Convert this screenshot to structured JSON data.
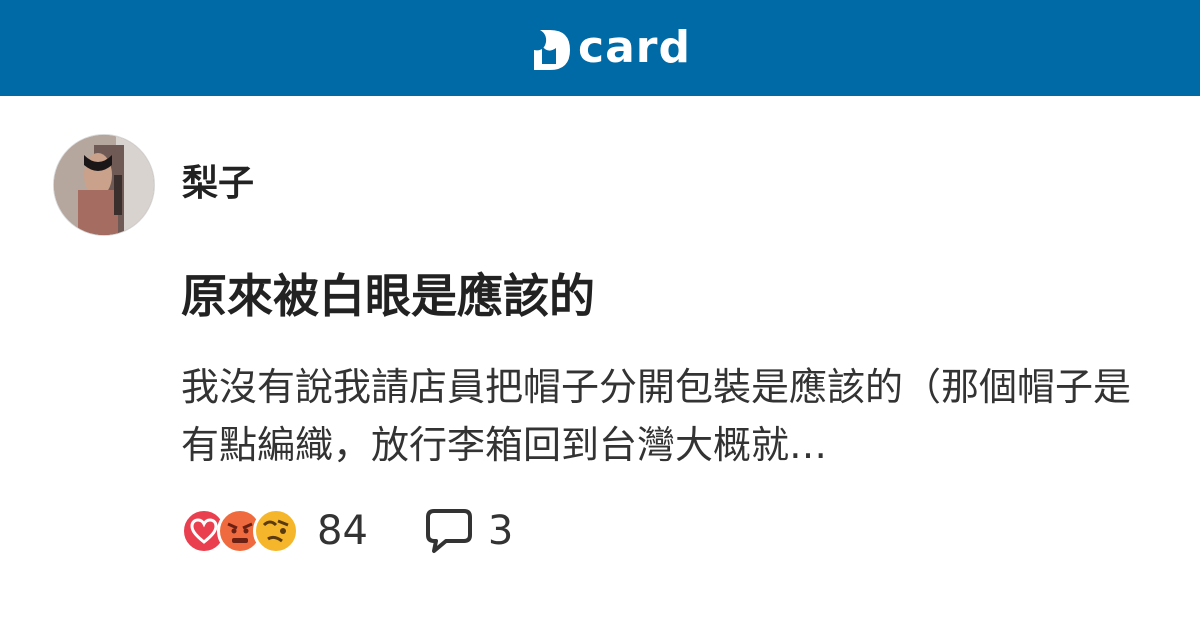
{
  "header": {
    "brand_text": "card",
    "brand_icon": "dcard-logo-icon",
    "bar_color": "#006aa6"
  },
  "post": {
    "author": "梨子",
    "avatar_icon": "user-avatar",
    "title": "原來被白眼是應該的",
    "excerpt": "我沒有說我請店員把帽子分開包裝是應該的（那個帽子是有點編織，放行李箱回到台灣大概就…",
    "reactions": {
      "icons": [
        "heart-reaction-icon",
        "angry-reaction-icon",
        "dizzy-reaction-icon"
      ],
      "count": "84"
    },
    "comments": {
      "icon": "comment-bubble-icon",
      "count": "3"
    }
  }
}
